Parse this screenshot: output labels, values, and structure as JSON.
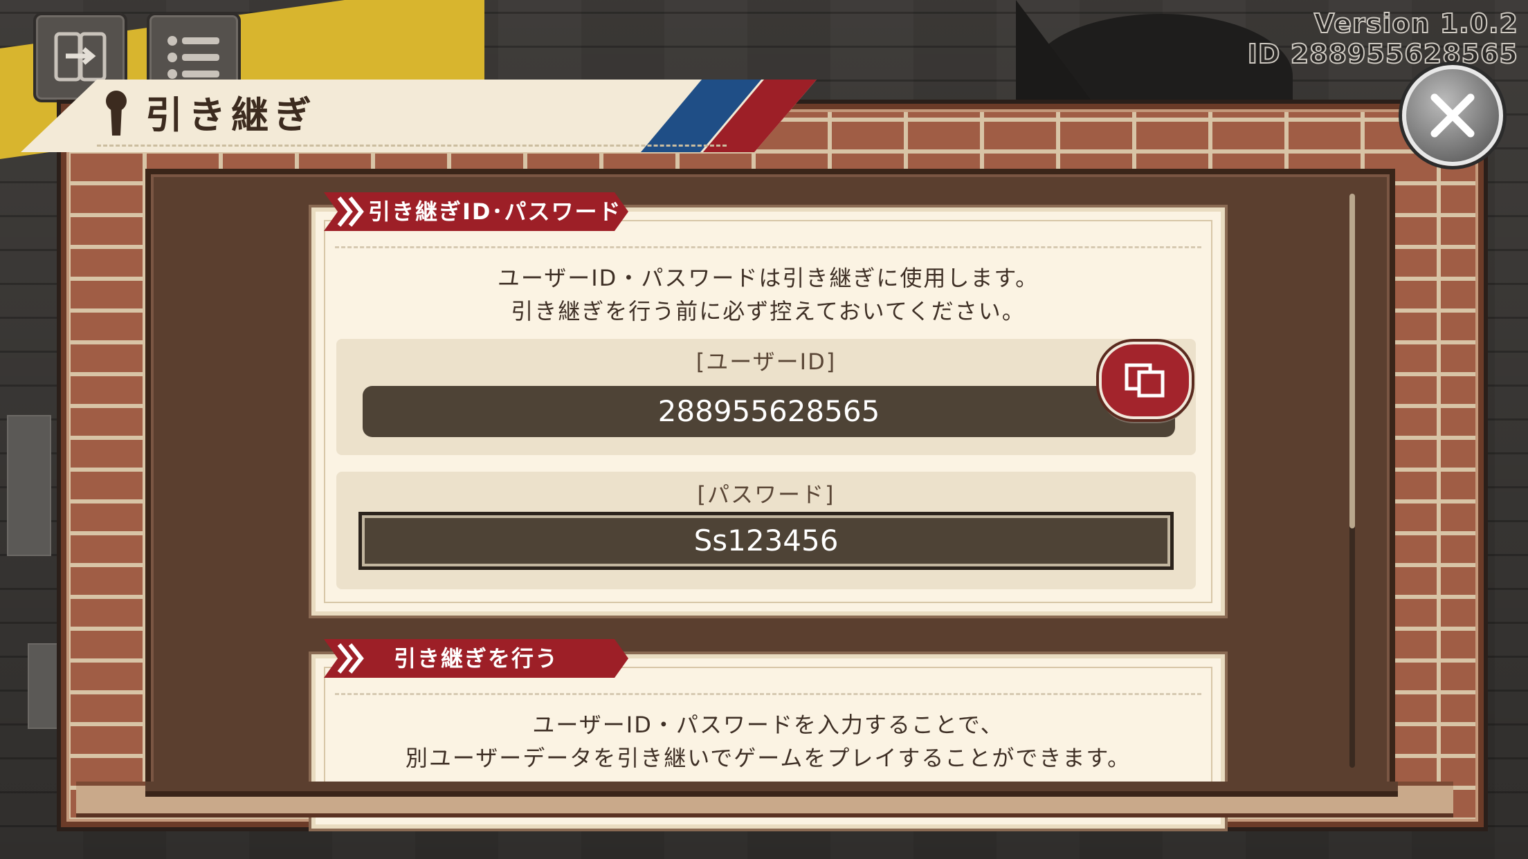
{
  "window": {
    "title": "引き継ぎ",
    "version": "Version 1.0.2",
    "id_line": "ID 288955628565"
  },
  "colors": {
    "accent_red": "#9d1f27",
    "accent_blue": "#1f4e86",
    "card_bg": "#fbf3e3",
    "field_bg": "#4e4336"
  },
  "icons": {
    "top_left_1": "transfer-phone-icon",
    "top_left_2": "menu-list-icon",
    "header": "keyhole-icon",
    "close": "close-icon",
    "copy": "copy-icon"
  },
  "section1": {
    "tag": "引き継ぎID･パスワード",
    "desc_line1": "ユーザーID・パスワードは引き継ぎに使用します。",
    "desc_line2": "引き継ぎを行う前に必ず控えておいてください。",
    "user_id_label": "[ユーザーID]",
    "user_id_value": "288955628565",
    "password_label": "[パスワード]",
    "password_value": "Ss123456"
  },
  "section2": {
    "tag": "引き継ぎを行う",
    "desc_line1": "ユーザーID・パスワードを入力することで、",
    "desc_line2": "別ユーザーデータを引き継いでゲームをプレイすることができます。"
  }
}
